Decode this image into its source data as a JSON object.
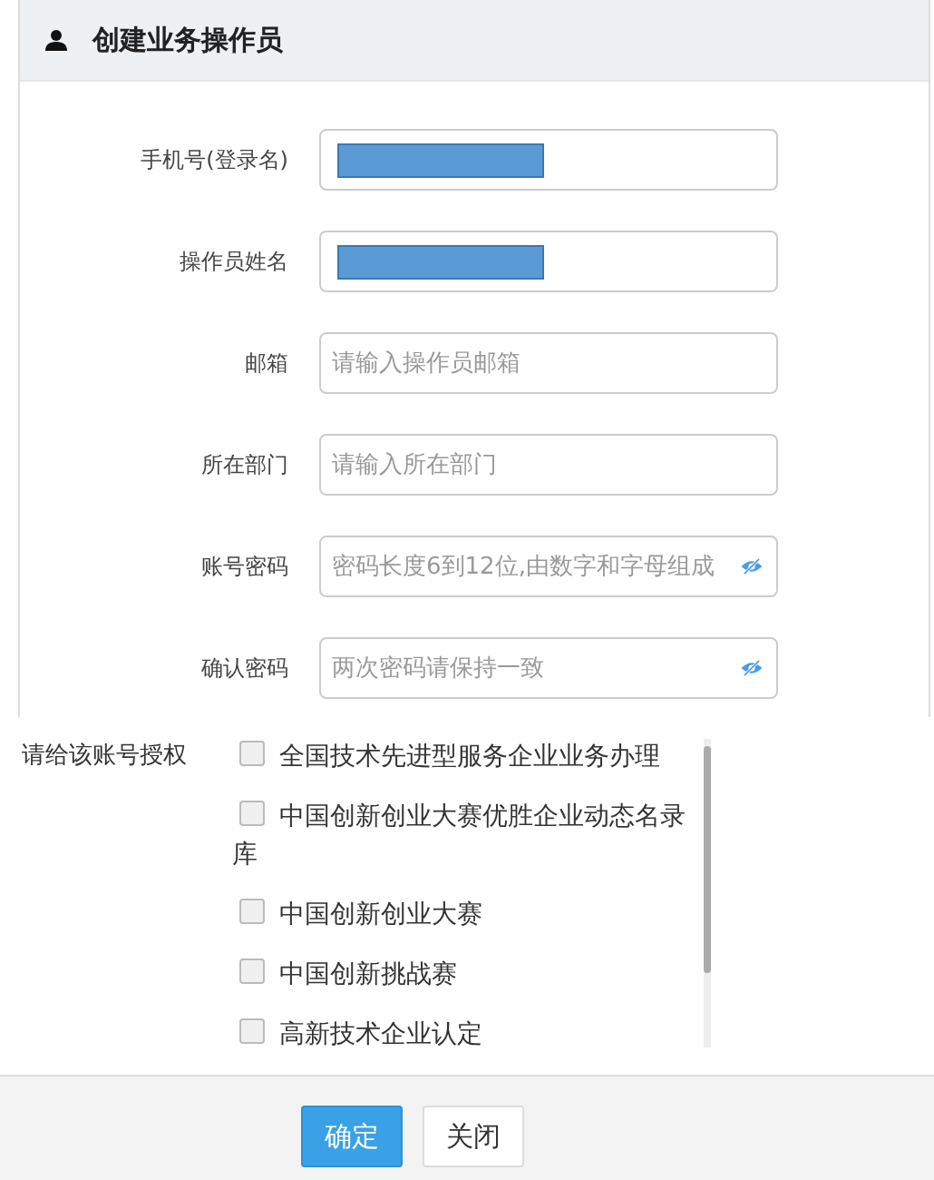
{
  "dialog": {
    "title": "创建业务操作员"
  },
  "fields": [
    {
      "label": "手机号(登录名)",
      "kind": "redacted"
    },
    {
      "label": "操作员姓名",
      "kind": "redacted"
    },
    {
      "label": "邮箱",
      "kind": "text",
      "placeholder": "请输入操作员邮箱"
    },
    {
      "label": "所在部门",
      "kind": "text",
      "placeholder": "请输入所在部门"
    },
    {
      "label": "账号密码",
      "kind": "password",
      "placeholder": "密码长度6到12位,由数字和字母组成"
    },
    {
      "label": "确认密码",
      "kind": "password",
      "placeholder": "两次密码请保持一致"
    }
  ],
  "permissions": {
    "label": "请给该账号授权",
    "items": [
      {
        "label": "全国技术先进型服务企业业务办理",
        "checked": false
      },
      {
        "label": "中国创新创业大赛优胜企业动态名录库",
        "checked": false
      },
      {
        "label": "中国创新创业大赛",
        "checked": false
      },
      {
        "label": "中国创新挑战赛",
        "checked": false
      },
      {
        "label": "高新技术企业认定",
        "checked": false
      }
    ]
  },
  "buttons": [
    {
      "label": "确定",
      "kind": "primary"
    },
    {
      "label": "关闭",
      "kind": "default"
    }
  ]
}
